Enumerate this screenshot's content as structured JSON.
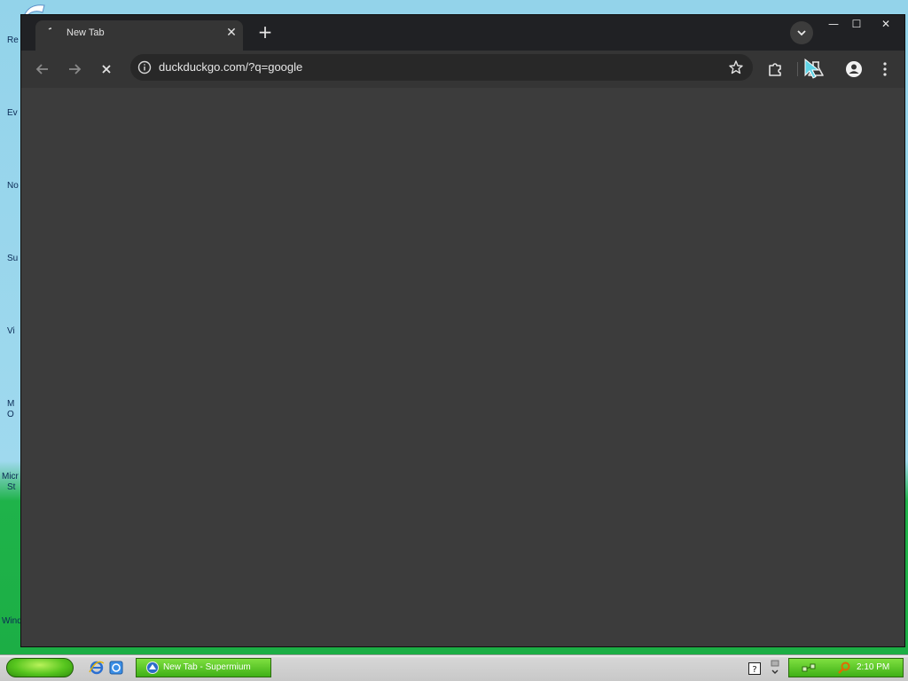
{
  "desktop": {
    "icon_labels": [
      "Re",
      "Ev",
      "No",
      "Su",
      "Vi",
      "M",
      "O",
      "Micr",
      "St",
      "Wind"
    ]
  },
  "browser": {
    "tab": {
      "title": "New Tab",
      "close_glyph": "✕"
    },
    "new_tab_glyph": "+",
    "caption": {
      "minimize": "—",
      "maximize": "☐",
      "close": "✕"
    },
    "toolbar": {
      "back_icon": "back-arrow-icon",
      "forward_icon": "forward-arrow-icon",
      "stop_icon": "stop-icon",
      "url": "duckduckgo.com/?q=google",
      "bookmark_icon": "star-icon",
      "extensions_icon": "puzzle-icon",
      "labs_icon": "flask-icon",
      "profile_icon": "person-icon",
      "menu_icon": "kebab-menu-icon"
    }
  },
  "taskbar": {
    "task_item_label": "New Tab - Supermium",
    "clock": "2:10 PM",
    "help_glyph": "?"
  },
  "colors": {
    "tabstrip": "#202124",
    "toolbar": "#353535",
    "content": "#3c3c3c",
    "taskbar_accent": "#3fb017"
  }
}
